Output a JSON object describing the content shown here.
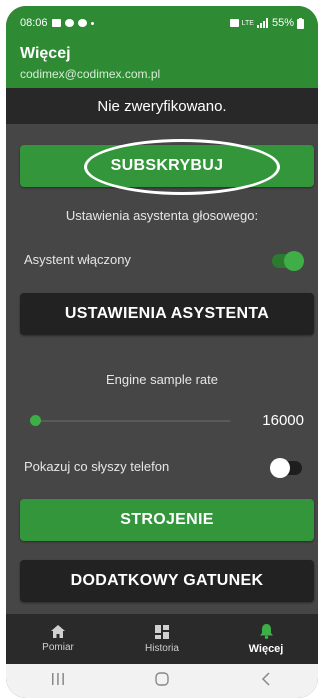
{
  "status_bar": {
    "time": "08:06",
    "battery": "55%",
    "network": "LTE"
  },
  "app_bar": {
    "title": "Więcej",
    "subtitle": "codimex@codimex.com.pl"
  },
  "verification": {
    "text": "Nie zweryfikowano."
  },
  "buttons": {
    "subscribe": "SUBSKRYBUJ",
    "assistant_settings": "USTAWIENIA ASYSTENTA",
    "tuning": "STROJENIE",
    "additional_species": "DODATKOWY GATUNEK"
  },
  "voice_assistant": {
    "section_label": "Ustawienia asystenta głosowego:",
    "enabled_label": "Asystent włączony",
    "enabled": true
  },
  "engine": {
    "label": "Engine sample rate",
    "value": "16000",
    "level": 0.04
  },
  "phone_hearing": {
    "label": "Pokazuj co słyszy telefon",
    "enabled": false
  },
  "bottom_nav": {
    "items": [
      {
        "label": "Pomiar",
        "icon": "home-icon"
      },
      {
        "label": "Historia",
        "icon": "dashboard-icon"
      },
      {
        "label": "Więcej",
        "icon": "bell-icon",
        "active": true
      }
    ]
  },
  "colors": {
    "primary_green": "#2f8a34",
    "button_green": "#33963a",
    "dark": "#222222",
    "background": "#464646"
  }
}
